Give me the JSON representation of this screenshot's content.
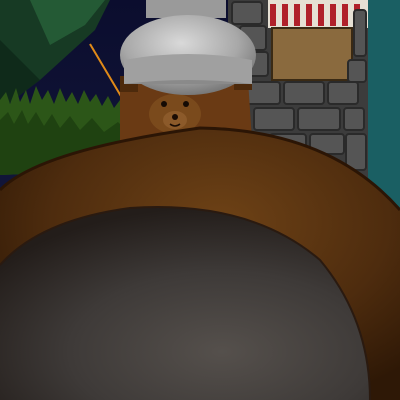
{
  "scene": {
    "view": "first-person",
    "colors": {
      "night_sky": "#0b0e2a",
      "tree_foliage": "#1f4a2c",
      "grass": "#2f5a1c",
      "stone_wall": "#4b4b4b",
      "awning_red": "#b0202a",
      "teal_wall": "#1a5f63",
      "teddy_bear_fur": "#6a3a14",
      "chef_hat_white": "#b9b9b9",
      "wooden_pot_rim": "#5a3410",
      "pot_interior": "#3e3a38",
      "orange_beam": "#e08a18"
    },
    "objects": [
      {
        "name": "teddy-bear",
        "description_icon": "bear-icon"
      },
      {
        "name": "chef-hat",
        "description_icon": "chef-hat-icon"
      },
      {
        "name": "cooking-pot",
        "description_icon": "pot-icon"
      },
      {
        "name": "stone-tower",
        "description_icon": "tower-icon"
      },
      {
        "name": "pine-tree",
        "description_icon": "tree-icon"
      },
      {
        "name": "grass-patch",
        "description_icon": "grass-icon"
      }
    ]
  }
}
